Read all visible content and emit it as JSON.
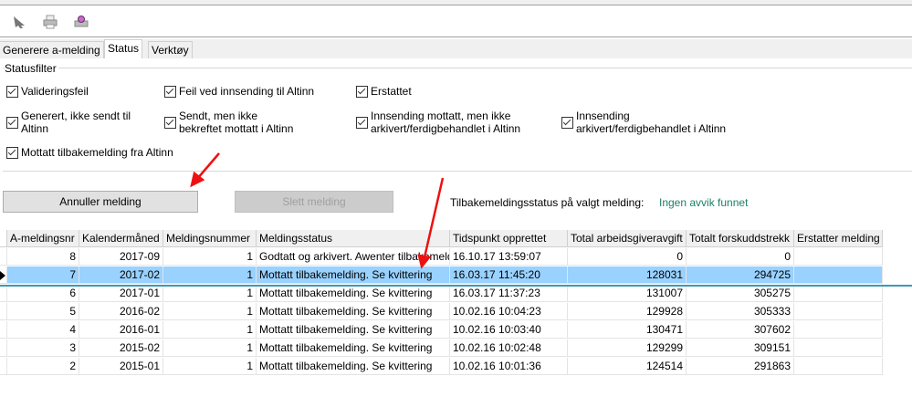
{
  "toolbar": {
    "icons": [
      "arrow-icon",
      "printer-icon",
      "print-preview-icon"
    ]
  },
  "tabs": [
    {
      "label": "Generere a-melding"
    },
    {
      "label": "Status",
      "active": true
    },
    {
      "label": "Verktøy"
    }
  ],
  "statusfilter": {
    "legend": "Statusfilter",
    "items": [
      {
        "label": "Valideringsfeil",
        "checked": true
      },
      {
        "label": "Feil ved innsending til Altinn",
        "checked": true
      },
      {
        "label": "Erstattet",
        "checked": true
      },
      {
        "label": "Generert, ikke sendt til",
        "label2": "Altinn",
        "checked": true
      },
      {
        "label": "Sendt, men ikke",
        "label2": "bekreftet mottatt i Altinn",
        "checked": true
      },
      {
        "label": "Innsending mottatt, men ikke",
        "label2": "arkivert/ferdigbehandlet i Altinn",
        "checked": true
      },
      {
        "label": "Innsending",
        "label2": "arkivert/ferdigbehandlet i Altinn",
        "checked": true
      },
      {
        "label": "Mottatt tilbakemelding fra Altinn",
        "checked": true
      }
    ]
  },
  "actions": {
    "cancel": "Annuller melding",
    "delete": "Slett melding",
    "status_label": "Tilbakemeldingsstatus på valgt melding:",
    "status_value": "Ingen avvik funnet",
    "status_color": "#1a7f6a"
  },
  "table": {
    "columns": [
      "A-meldingsnr",
      "Kalendermåned",
      "Meldingsnummer",
      "Meldingsstatus",
      "Tidspunkt opprettet",
      "Total arbeidsgiveravgift",
      "Totalt forskuddstrekk",
      "Erstatter melding"
    ],
    "rows": [
      [
        "8",
        "2017-09",
        "1",
        "Godtatt og arkivert. Awenter tilbakemelding",
        "16.10.17 13:59:07",
        "0",
        "0",
        ""
      ],
      [
        "7",
        "2017-02",
        "1",
        "Mottatt tilbakemelding. Se kvittering",
        "16.03.17 11:45:20",
        "128031",
        "294725",
        ""
      ],
      [
        "6",
        "2017-01",
        "1",
        "Mottatt tilbakemelding. Se kvittering",
        "16.03.17 11:37:23",
        "131007",
        "305275",
        ""
      ],
      [
        "5",
        "2016-02",
        "1",
        "Mottatt tilbakemelding. Se kvittering",
        "10.02.16 10:04:23",
        "129928",
        "305333",
        ""
      ],
      [
        "4",
        "2016-01",
        "1",
        "Mottatt tilbakemelding. Se kvittering",
        "10.02.16 10:03:40",
        "130471",
        "307602",
        ""
      ],
      [
        "3",
        "2015-02",
        "1",
        "Mottatt tilbakemelding. Se kvittering",
        "10.02.16 10:02:48",
        "129299",
        "309151",
        ""
      ],
      [
        "2",
        "2015-01",
        "1",
        "Mottatt tilbakemelding. Se kvittering",
        "10.02.16 10:01:36",
        "124514",
        "291863",
        ""
      ]
    ],
    "selected_row": 1
  },
  "colors": {
    "selection": "#99d1ff",
    "annotation_arrow": "#ee1111"
  }
}
